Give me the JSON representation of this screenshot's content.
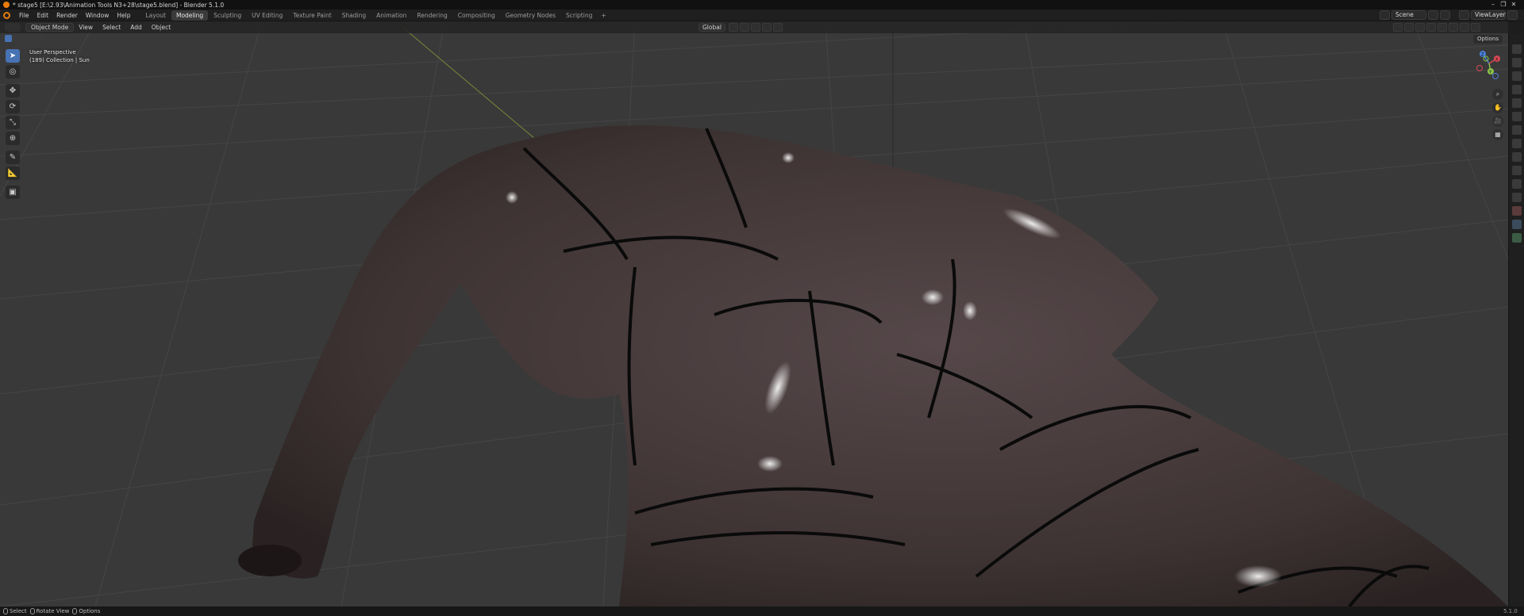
{
  "window": {
    "title": "* stage5 [E:\\2.93\\Animation Tools N3+28\\stage5.blend] - Blender 5.1.0",
    "controls": [
      "–",
      "❐",
      "✕"
    ]
  },
  "menubar": {
    "menus": [
      "File",
      "Edit",
      "Render",
      "Window",
      "Help"
    ],
    "workspaces": [
      "Layout",
      "Modeling",
      "Sculpting",
      "UV Editing",
      "Texture Paint",
      "Shading",
      "Animation",
      "Rendering",
      "Compositing",
      "Geometry Nodes",
      "Scripting"
    ],
    "active_workspace": "Modeling",
    "add_workspace": "+",
    "scene": "Scene",
    "view_layer": "ViewLayer"
  },
  "viewport_header": {
    "mode": "Object Mode",
    "menus": [
      "View",
      "Select",
      "Add",
      "Object"
    ],
    "transform_orientation": "Global"
  },
  "viewport": {
    "view_name": "User Perspective",
    "collection_info": "(189) Collection | Sun",
    "options_label": "Options",
    "gizmo": {
      "x": "X",
      "y": "Y",
      "z": "Z"
    },
    "colors": {
      "background": "#393939",
      "mesh": "#463a38",
      "x_axis": "#d94a55",
      "y_axis": "#8bc34a",
      "z_axis": "#4a7fd9"
    }
  },
  "toolbar": {
    "tools": [
      {
        "name": "select-box",
        "icon": "cursor-icon",
        "glyph": "➤",
        "active": true
      },
      {
        "name": "cursor",
        "icon": "3d-cursor-icon",
        "glyph": "◎"
      },
      {
        "name": "move",
        "icon": "move-icon",
        "glyph": "✥"
      },
      {
        "name": "rotate",
        "icon": "rotate-icon",
        "glyph": "⟳"
      },
      {
        "name": "scale",
        "icon": "scale-icon",
        "glyph": "⤡"
      },
      {
        "name": "transform",
        "icon": "transform-icon",
        "glyph": "⊕"
      },
      {
        "name": "annotate",
        "icon": "annotate-icon",
        "glyph": "✎"
      },
      {
        "name": "measure",
        "icon": "measure-icon",
        "glyph": "📐"
      },
      {
        "name": "add-cube",
        "icon": "add-cube-icon",
        "glyph": "▣"
      }
    ]
  },
  "statusbar": {
    "items": [
      "Select",
      "Rotate View",
      "Options"
    ],
    "version": "5.1.0"
  }
}
